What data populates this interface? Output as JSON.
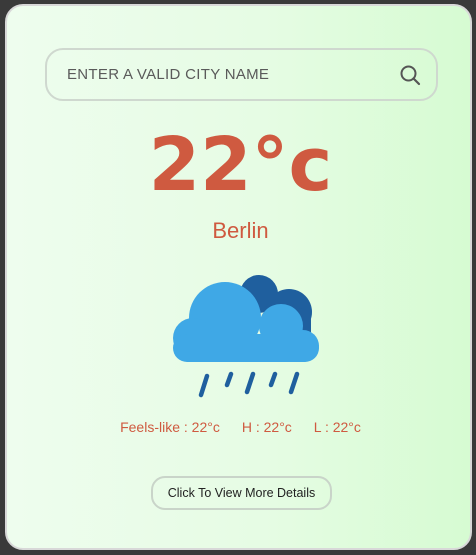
{
  "search": {
    "placeholder": "ENTER A VALID CITY NAME",
    "icon": "search-icon"
  },
  "weather": {
    "temperature": "22°c",
    "city": "Berlin",
    "condition_icon": "rain-cloud-icon",
    "feels_like": "Feels-like : 22°c",
    "high": "H : 22°c",
    "low": "L : 22°c"
  },
  "actions": {
    "details_label": "Click To View More Details"
  },
  "colors": {
    "accent": "#cf5a40",
    "cloud_front": "#3fa8e6",
    "cloud_back": "#1f5f9e",
    "card_bg_start": "#eefdee",
    "card_bg_end": "#d6fbd2"
  }
}
